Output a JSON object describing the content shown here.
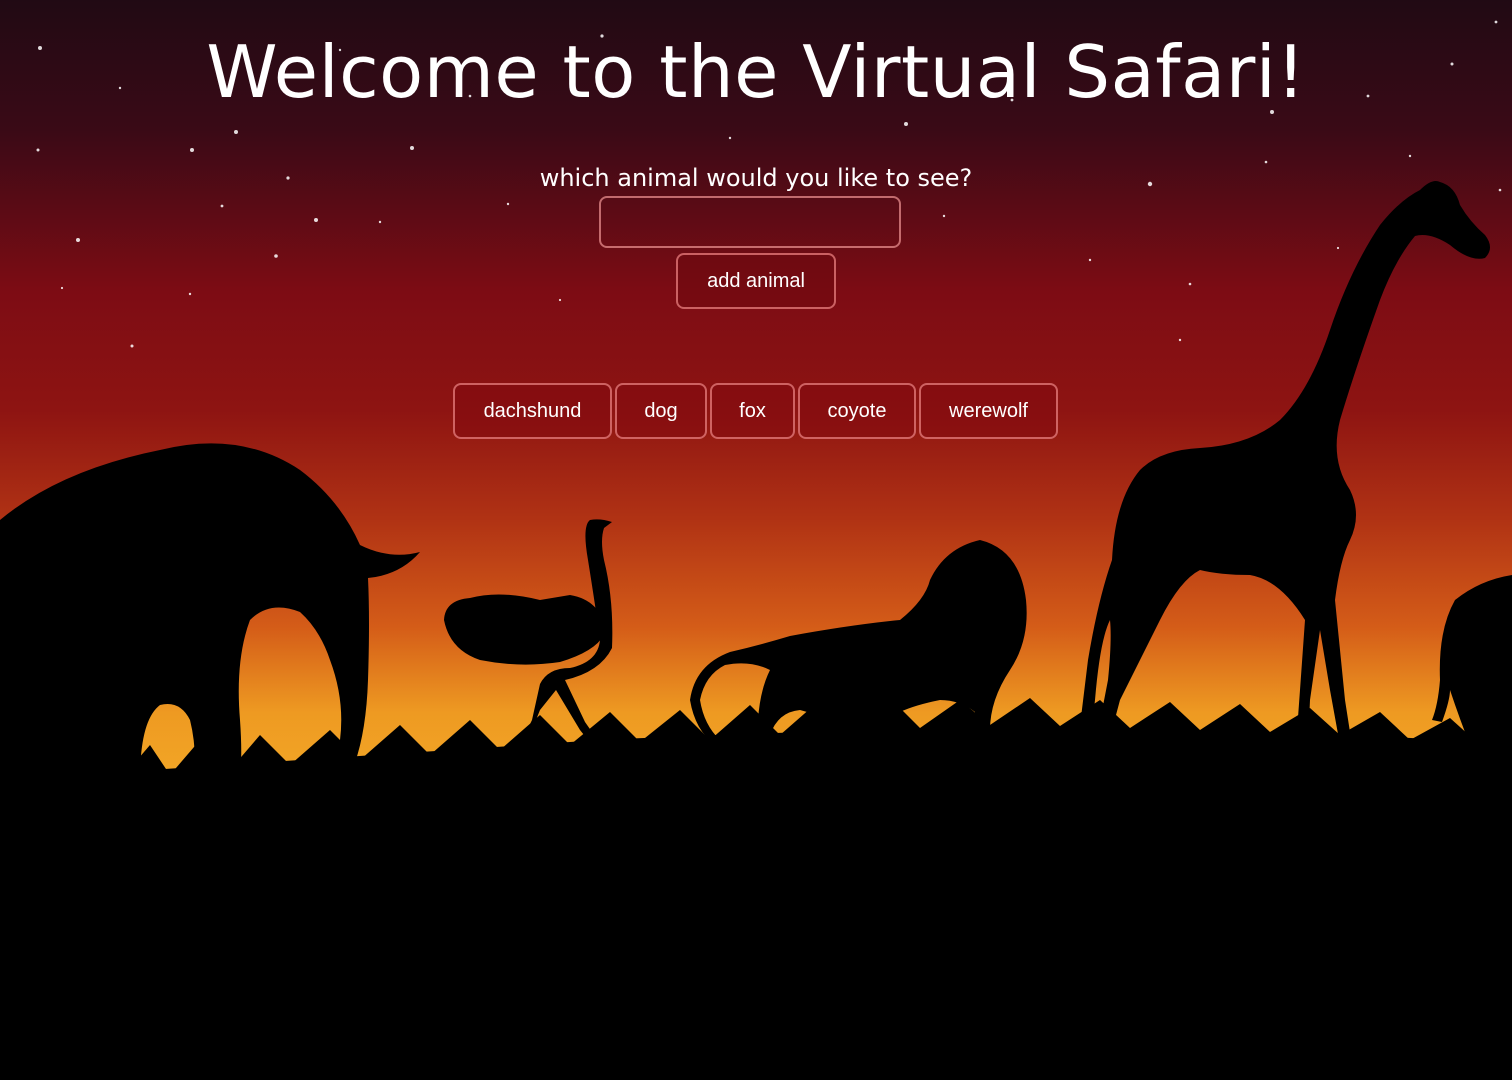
{
  "page": {
    "title": "Welcome to the Virtual Safari!",
    "prompt": "which animal would you like to see?"
  },
  "form": {
    "input_value": "",
    "input_placeholder": "",
    "add_button_label": "add animal"
  },
  "animals": [
    {
      "label": "dachshund"
    },
    {
      "label": "dog"
    },
    {
      "label": "fox"
    },
    {
      "label": "coyote"
    },
    {
      "label": "werewolf"
    }
  ],
  "colors": {
    "sky_top": "#220a14",
    "sky_mid": "#8a0e14",
    "horizon": "#f0a020",
    "ground": "#000000",
    "button_border": "#e07878",
    "text": "#ffffff"
  }
}
